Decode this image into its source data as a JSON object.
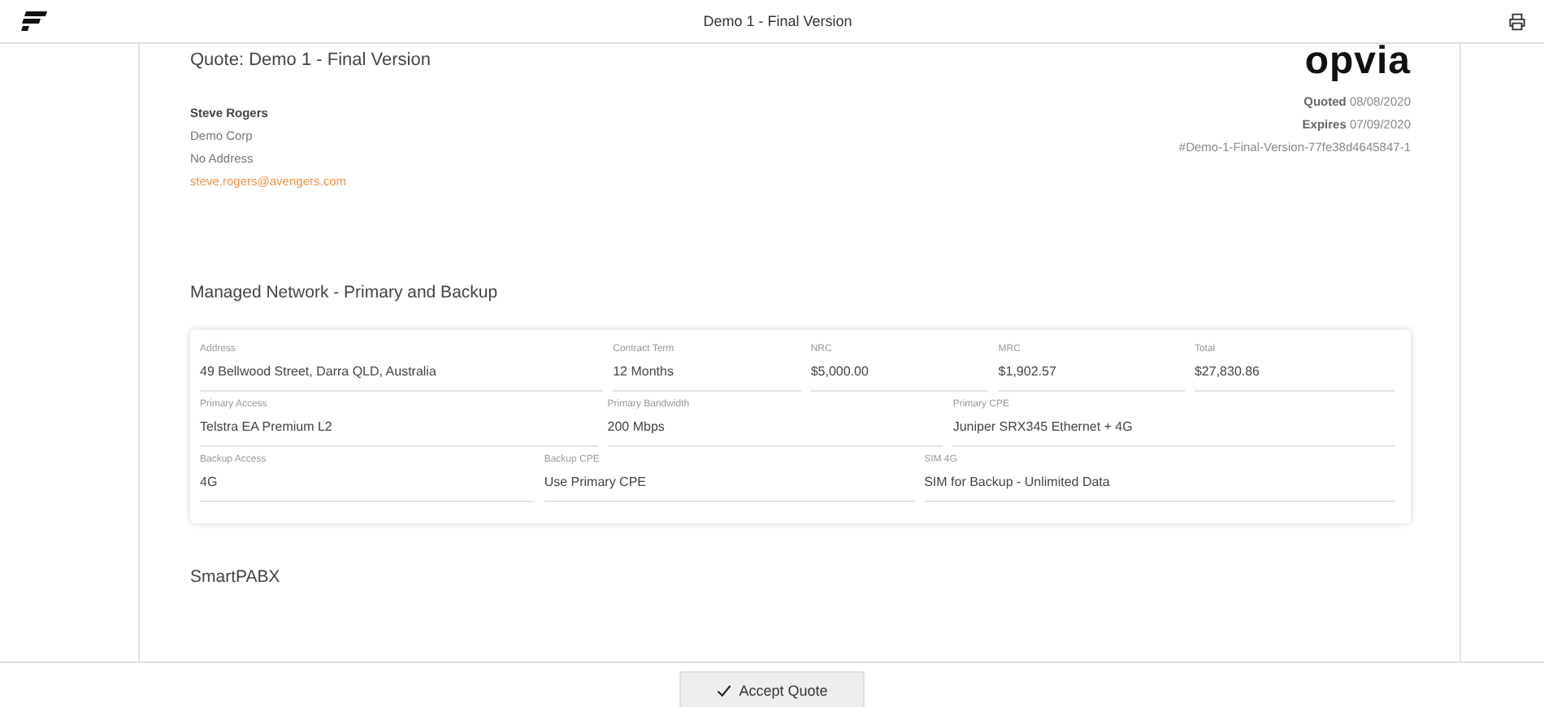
{
  "header": {
    "title": "Demo 1 - Final Version"
  },
  "quote": {
    "title": "Quote: Demo 1 - Final Version",
    "logo": "opvia",
    "customer": {
      "name": "Steve Rogers",
      "company": "Demo Corp",
      "address": "No Address",
      "email": "steve.rogers@avengers.com"
    },
    "meta": [
      {
        "label": "Quoted",
        "value": "08/08/2020"
      },
      {
        "label": "Expires",
        "value": "07/09/2020"
      }
    ],
    "reference": "#Demo-1-Final-Version-77fe38d4645847-1"
  },
  "sections": [
    {
      "title": "Managed Network - Primary and Backup",
      "rows": [
        [
          {
            "label": "Address",
            "value": "49 Bellwood Street, Darra QLD, Australia"
          },
          {
            "label": "Contract Term",
            "value": "12 Months"
          },
          {
            "label": "NRC",
            "value": "$5,000.00"
          },
          {
            "label": "MRC",
            "value": "$1,902.57"
          },
          {
            "label": "Total",
            "value": "$27,830.86"
          }
        ],
        [
          {
            "label": "Primary Access",
            "value": "Telstra EA Premium L2"
          },
          {
            "label": "Primary Bandwidth",
            "value": "200 Mbps"
          },
          {
            "label": "Primary CPE",
            "value": "Juniper SRX345 Ethernet + 4G"
          }
        ],
        [
          {
            "label": "Backup Access",
            "value": "4G"
          },
          {
            "label": "Backup CPE",
            "value": "Use Primary CPE"
          },
          {
            "label": "SIM 4G",
            "value": "SIM for Backup - Unlimited Data"
          }
        ]
      ]
    },
    {
      "title": "SmartPABX"
    }
  ],
  "footer": {
    "button": "Accept Quote"
  }
}
